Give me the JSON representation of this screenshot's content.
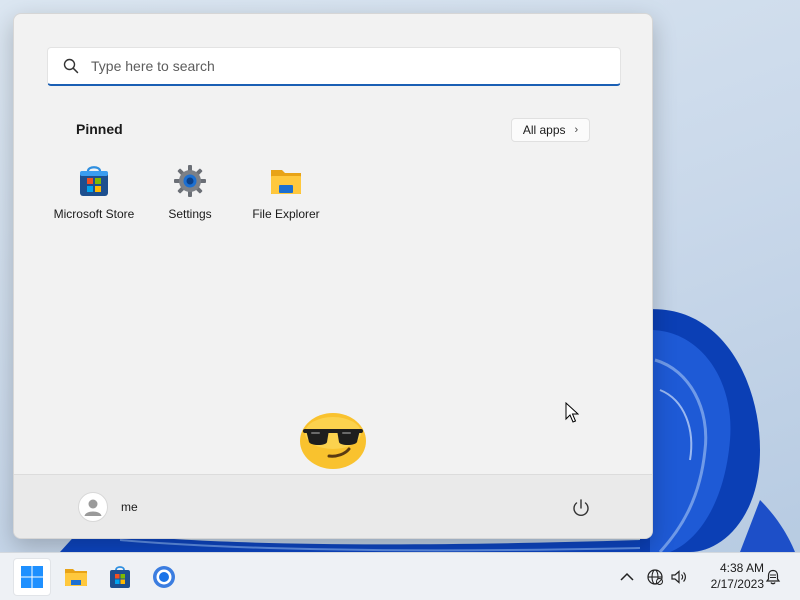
{
  "search": {
    "placeholder": "Type here to search"
  },
  "pinned": {
    "heading": "Pinned",
    "all_apps_label": "All apps",
    "apps": [
      {
        "label": "Microsoft Store",
        "icon": "microsoft-store-icon"
      },
      {
        "label": "Settings",
        "icon": "settings-gear-icon"
      },
      {
        "label": "File Explorer",
        "icon": "file-explorer-folder-icon"
      }
    ]
  },
  "user": {
    "name": "me",
    "icon": "user-avatar-icon"
  },
  "power": {
    "icon": "power-icon"
  },
  "taskbar": {
    "items": [
      {
        "name": "start",
        "icon": "windows-start-icon",
        "active": true
      },
      {
        "name": "file-explorer",
        "icon": "file-explorer-folder-icon"
      },
      {
        "name": "microsoft-store",
        "icon": "microsoft-store-icon"
      },
      {
        "name": "chrome",
        "icon": "chrome-browser-icon"
      }
    ],
    "tray": {
      "icons": [
        "chevron-up-icon",
        "network-globe-icon",
        "volume-icon",
        "notification-bell-icon"
      ],
      "time": "4:38 AM",
      "date": "2/17/2023"
    }
  },
  "colors": {
    "accent": "#1a5fb4",
    "wallpaper_bloom": "#0a3fb8",
    "menu_background": "#f2f2f2",
    "taskbar_background": "#eef1f5"
  }
}
